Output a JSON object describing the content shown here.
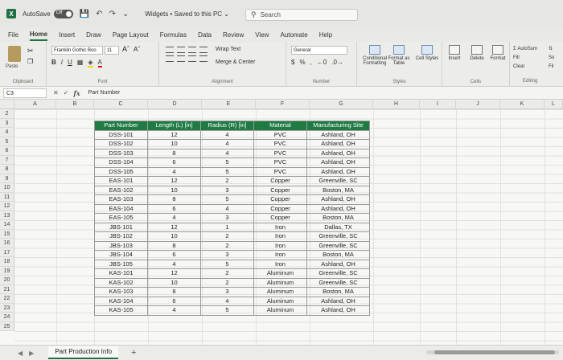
{
  "titlebar": {
    "autosave_label": "AutoSave",
    "autosave_state": "Off",
    "doc_title": "Widgets • Saved to this PC ⌄",
    "search_placeholder": "Search"
  },
  "ribbon_tabs": [
    "File",
    "Home",
    "Insert",
    "Draw",
    "Page Layout",
    "Formulas",
    "Data",
    "Review",
    "View",
    "Automate",
    "Help"
  ],
  "active_tab": "Home",
  "ribbon": {
    "clipboard": {
      "paste_label": "Paste",
      "group_label": "Clipboard"
    },
    "font": {
      "font_name": "Franklin Gothic Boo",
      "font_size": "11",
      "group_label": "Font"
    },
    "alignment": {
      "wrap_text": "Wrap Text",
      "merge_center": "Merge & Center",
      "group_label": "Alignment"
    },
    "number": {
      "format": "General",
      "currency": "$",
      "percent": "%",
      "comma": ",",
      "group_label": "Number"
    },
    "styles": {
      "conditional": "Conditional Formatting",
      "format_as_table": "Format as Table",
      "cell_styles": "Cell Styles",
      "group_label": "Styles"
    },
    "cells": {
      "insert": "Insert",
      "delete": "Delete",
      "format": "Format",
      "group_label": "Cells"
    },
    "editing": {
      "autosum": "Σ AutoSum",
      "fill": "Fill",
      "clear": "Clear",
      "group_label": "Editing",
      "sort_partial": "So",
      "filter_partial": "Fil"
    }
  },
  "formula_bar": {
    "name_box": "C3",
    "content": "Part Number"
  },
  "columns": [
    "A",
    "B",
    "C",
    "D",
    "E",
    "F",
    "G",
    "H",
    "I",
    "J",
    "K",
    "L"
  ],
  "rows": [
    "2",
    "3",
    "4",
    "5",
    "6",
    "7",
    "8",
    "9",
    "10",
    "11",
    "12",
    "13",
    "14",
    "15",
    "16",
    "17",
    "18",
    "19",
    "20",
    "21",
    "22",
    "23",
    "24",
    "25"
  ],
  "table": {
    "headers": [
      "Part Number",
      "Length (L) [in]",
      "Radius (R) [in]",
      "Material",
      "Manufacturing Site"
    ],
    "rows": [
      [
        "DSS-101",
        "12",
        "4",
        "PVC",
        "Ashland, OH"
      ],
      [
        "DSS-102",
        "10",
        "4",
        "PVC",
        "Ashland, OH"
      ],
      [
        "DSS-103",
        "8",
        "4",
        "PVC",
        "Ashland, OH"
      ],
      [
        "DSS-104",
        "6",
        "5",
        "PVC",
        "Ashland, OH"
      ],
      [
        "DSS-105",
        "4",
        "5",
        "PVC",
        "Ashland, OH"
      ],
      [
        "EAS-101",
        "12",
        "2",
        "Copper",
        "Greenville, SC"
      ],
      [
        "EAS-102",
        "10",
        "3",
        "Copper",
        "Boston, MA"
      ],
      [
        "EAS-103",
        "8",
        "5",
        "Copper",
        "Ashland, OH"
      ],
      [
        "EAS-104",
        "6",
        "4",
        "Copper",
        "Ashland, OH"
      ],
      [
        "EAS-105",
        "4",
        "3",
        "Copper",
        "Boston, MA"
      ],
      [
        "JBS-101",
        "12",
        "1",
        "Iron",
        "Dallas, TX"
      ],
      [
        "JBS-102",
        "10",
        "2",
        "Iron",
        "Greenville, SC"
      ],
      [
        "JBS-103",
        "8",
        "2",
        "Iron",
        "Greenville, SC"
      ],
      [
        "JBS-104",
        "6",
        "3",
        "Iron",
        "Boston, MA"
      ],
      [
        "JBS-105",
        "4",
        "5",
        "Iron",
        "Ashland, OH"
      ],
      [
        "KAS-101",
        "12",
        "2",
        "Aluminum",
        "Greenville, SC"
      ],
      [
        "KAS-102",
        "10",
        "2",
        "Aluminum",
        "Greenville, SC"
      ],
      [
        "KAS-103",
        "8",
        "3",
        "Aluminum",
        "Boston, MA"
      ],
      [
        "KAS-104",
        "6",
        "4",
        "Aluminum",
        "Ashland, OH"
      ],
      [
        "KAS-105",
        "4",
        "5",
        "Aluminum",
        "Ashland, OH"
      ]
    ]
  },
  "sheet_tabs": {
    "active": "Part Production Info",
    "add_label": "+"
  },
  "colors": {
    "accent": "#1e7145",
    "header_fill": "#1f7a44"
  }
}
